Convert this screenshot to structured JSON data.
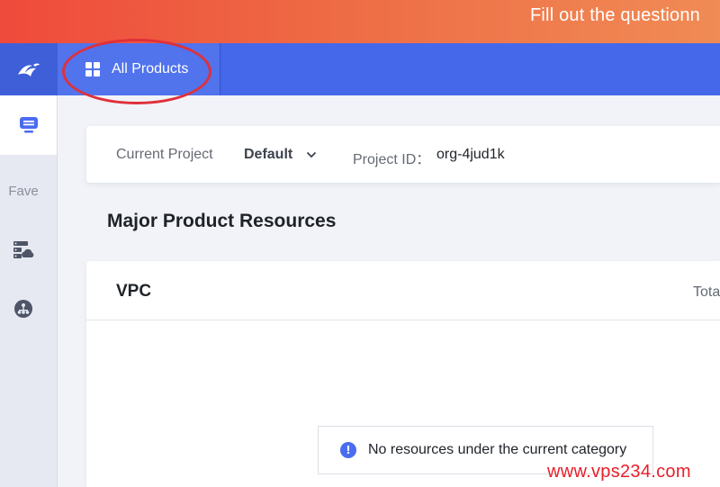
{
  "banner": {
    "text": "Fill out the questionn"
  },
  "topbar": {
    "logo_icon": "bird-logo-icon",
    "all_products_label": "All Products",
    "all_products_icon": "grid-icon",
    "highlight_color": "#e0303a"
  },
  "sidebar": {
    "items": [
      {
        "icon": "monitor-icon",
        "active": true
      },
      {
        "label": "Fave"
      },
      {
        "icon": "server-cloud-icon"
      },
      {
        "icon": "network-topology-icon"
      }
    ]
  },
  "project_bar": {
    "current_project_label": "Current Project",
    "current_project_value": "Default",
    "project_id_label": "Project ID：",
    "project_id_value": "org-4jud1k"
  },
  "main": {
    "section_title": "Major Product Resources",
    "card": {
      "title": "VPC",
      "total_label": "Tota",
      "empty_message": "No resources under the current category",
      "empty_icon": "info-icon"
    }
  },
  "watermark": {
    "text": "www.vps234.com"
  },
  "colors": {
    "topbar": "#4568ea",
    "accent": "#4a6cf0",
    "banner_start": "#ef4a3c",
    "banner_end": "#f08b55"
  }
}
